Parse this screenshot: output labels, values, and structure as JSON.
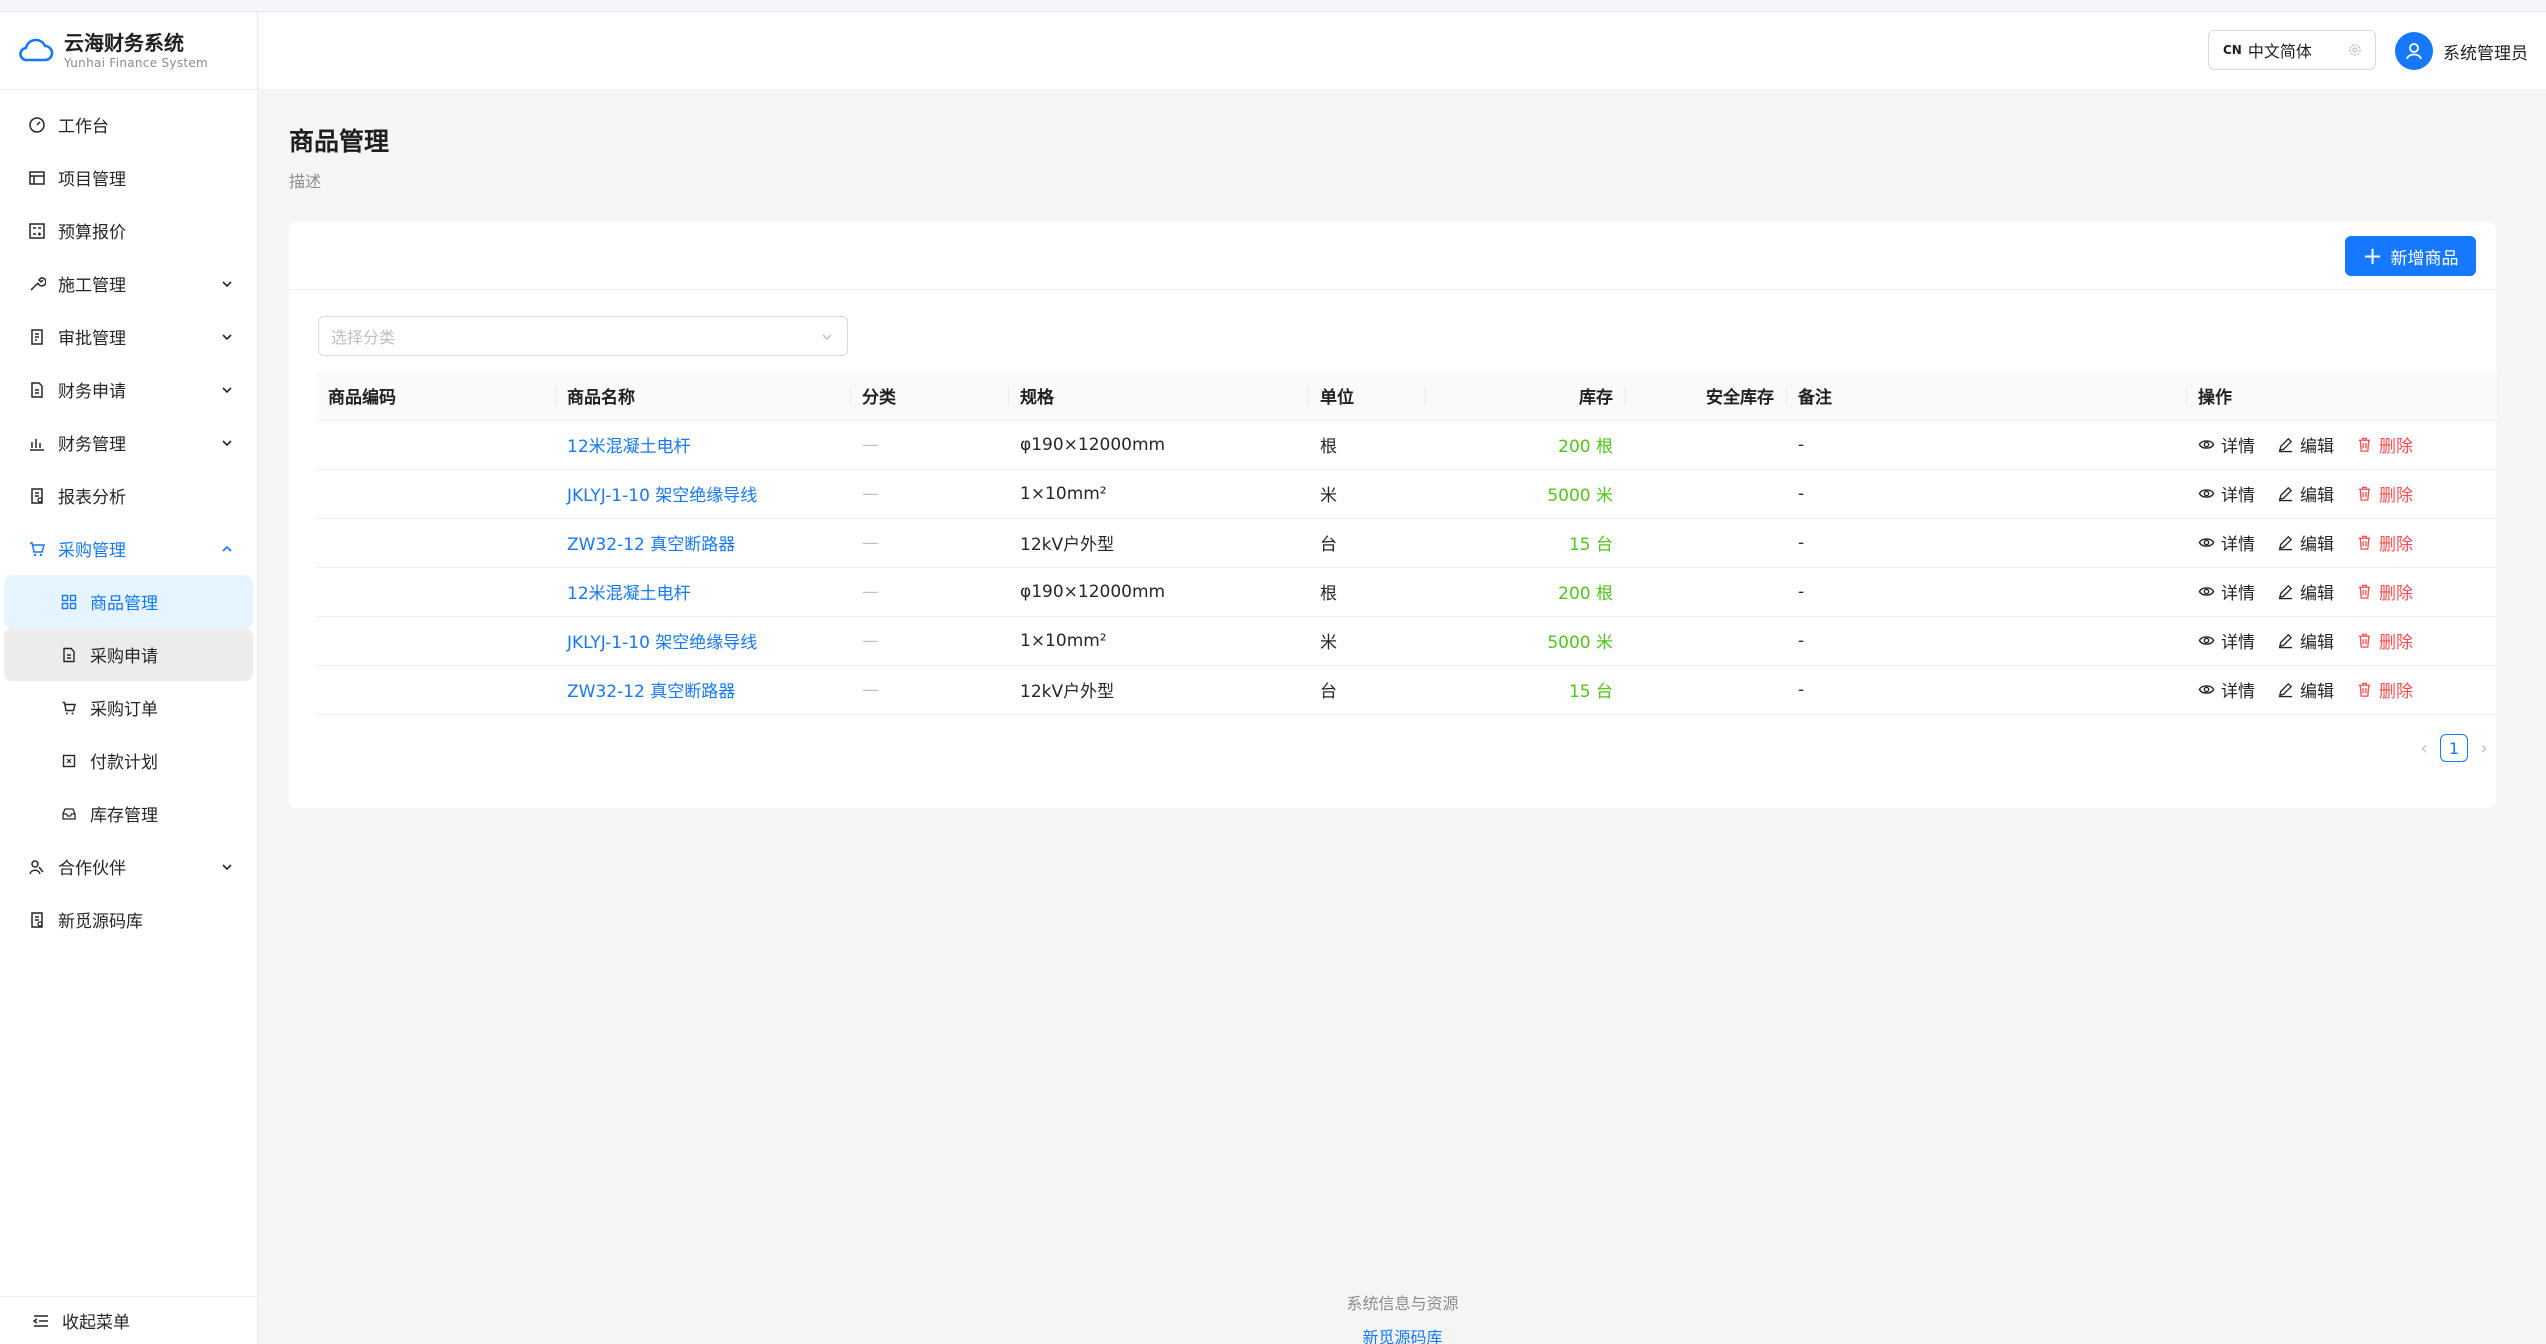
{
  "app": {
    "title": "云海财务系统",
    "subtitle": "Yunhai Finance System"
  },
  "sidebar": {
    "items": [
      {
        "label": "工作台",
        "icon": "dashboard-icon"
      },
      {
        "label": "项目管理",
        "icon": "project-icon"
      },
      {
        "label": "预算报价",
        "icon": "calculator-icon"
      },
      {
        "label": "施工管理",
        "icon": "tool-icon",
        "expandable": true
      },
      {
        "label": "审批管理",
        "icon": "audit-icon",
        "expandable": true
      },
      {
        "label": "财务申请",
        "icon": "file-icon",
        "expandable": true
      },
      {
        "label": "财务管理",
        "icon": "bar-chart-icon",
        "expandable": true
      },
      {
        "label": "报表分析",
        "icon": "report-icon"
      },
      {
        "label": "采购管理",
        "icon": "cart-icon",
        "expandable": true,
        "open": true
      }
    ],
    "sub_items": [
      {
        "label": "商品管理",
        "icon": "appstore-icon",
        "active": true
      },
      {
        "label": "采购申请",
        "icon": "file-text-icon"
      },
      {
        "label": "采购订单",
        "icon": "cart-icon"
      },
      {
        "label": "付款计划",
        "icon": "schedule-icon"
      },
      {
        "label": "库存管理",
        "icon": "inbox-icon"
      }
    ],
    "after_items": [
      {
        "label": "合作伙伴",
        "icon": "partner-icon",
        "expandable": true
      },
      {
        "label": "新觅源码库",
        "icon": "report-icon"
      }
    ],
    "collapse_label": "收起菜单"
  },
  "header": {
    "lang_code": "CN",
    "lang_label": "中文简体",
    "user_name": "系统管理员"
  },
  "page": {
    "title": "商品管理",
    "desc": "描述"
  },
  "toolbar": {
    "add_label": "新增商品"
  },
  "filter": {
    "placeholder": "选择分类"
  },
  "table": {
    "columns": [
      "商品编码",
      "商品名称",
      "分类",
      "规格",
      "单位",
      "库存",
      "安全库存",
      "备注",
      "操作"
    ],
    "rows": [
      {
        "code": "",
        "name": "12米混凝土电杆",
        "category": "—",
        "spec": "φ190×12000mm",
        "unit": "根",
        "stock": "200 根",
        "safety": "",
        "remark": "-"
      },
      {
        "code": "",
        "name": "JKLYJ-1-10 架空绝缘导线",
        "category": "—",
        "spec": "1×10mm²",
        "unit": "米",
        "stock": "5000 米",
        "safety": "",
        "remark": "-"
      },
      {
        "code": "",
        "name": "ZW32-12 真空断路器",
        "category": "—",
        "spec": "12kV户外型",
        "unit": "台",
        "stock": "15 台",
        "safety": "",
        "remark": "-"
      },
      {
        "code": "",
        "name": "12米混凝土电杆",
        "category": "—",
        "spec": "φ190×12000mm",
        "unit": "根",
        "stock": "200 根",
        "safety": "",
        "remark": "-"
      },
      {
        "code": "",
        "name": "JKLYJ-1-10 架空绝缘导线",
        "category": "—",
        "spec": "1×10mm²",
        "unit": "米",
        "stock": "5000 米",
        "safety": "",
        "remark": "-"
      },
      {
        "code": "",
        "name": "ZW32-12 真空断路器",
        "category": "—",
        "spec": "12kV户外型",
        "unit": "台",
        "stock": "15 台",
        "safety": "",
        "remark": "-"
      }
    ],
    "actions": {
      "detail": "详情",
      "edit": "编辑",
      "delete": "删除"
    }
  },
  "pagination": {
    "current": "1"
  },
  "footer": {
    "line1": "系统信息与资源",
    "link": "新觅源码库"
  },
  "colors": {
    "primary": "#1677ff",
    "success": "#52c41a",
    "danger": "#ff4d4f"
  }
}
